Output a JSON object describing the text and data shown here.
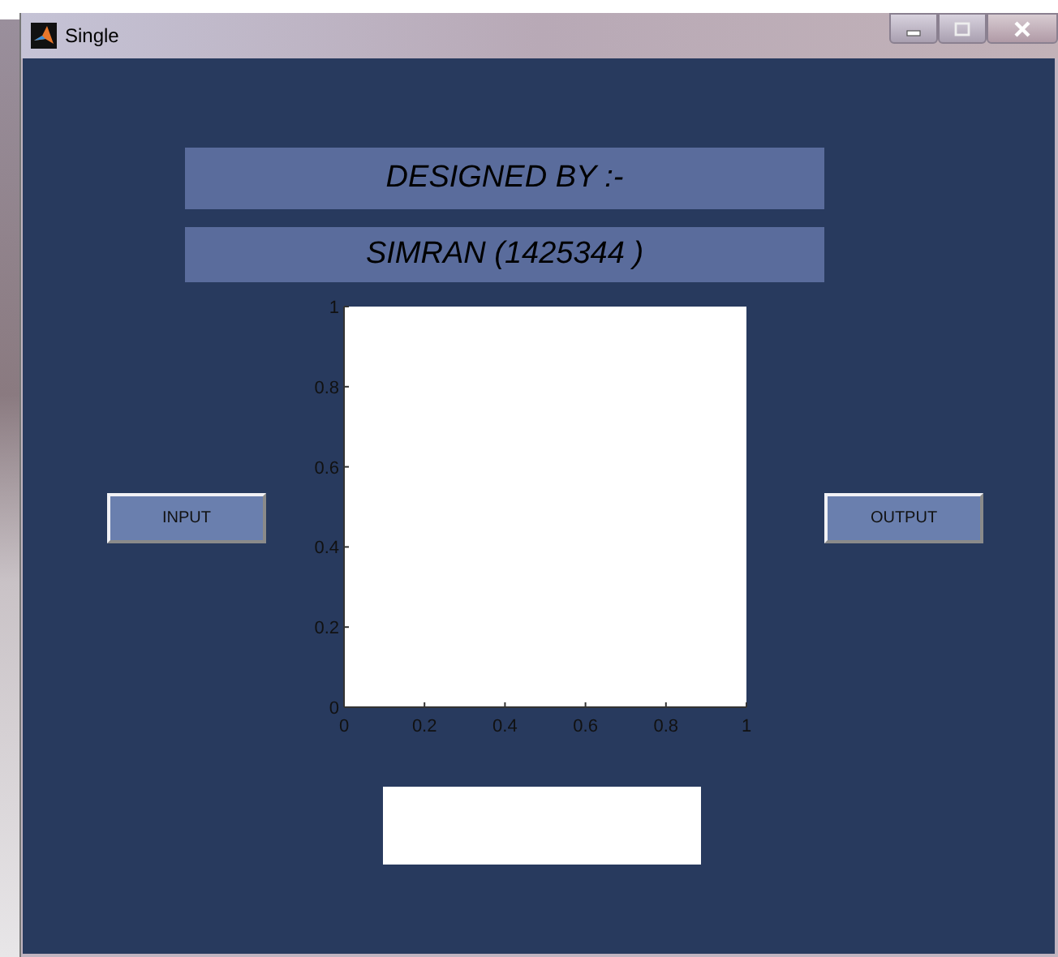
{
  "window": {
    "title": "Single"
  },
  "banners": [
    "DESIGNED BY :-",
    "SIMRAN (1425344 )"
  ],
  "buttons": [
    "INPUT",
    "OUTPUT"
  ],
  "axes": {
    "chart_data": {
      "type": "line",
      "xlim": [
        0,
        1
      ],
      "ylim": [
        0,
        1
      ],
      "xticks": [
        {
          "value": 0,
          "label": "0"
        },
        {
          "value": 0.2,
          "label": "0.2"
        },
        {
          "value": 0.4,
          "label": "0.4"
        },
        {
          "value": 0.6,
          "label": "0.6"
        },
        {
          "value": 0.8,
          "label": "0.8"
        },
        {
          "value": 1,
          "label": "1"
        }
      ],
      "yticks": [
        {
          "value": 0,
          "label": "0"
        },
        {
          "value": 0.2,
          "label": "0.2"
        },
        {
          "value": 0.4,
          "label": "0.4"
        },
        {
          "value": 0.6,
          "label": "0.6"
        },
        {
          "value": 0.8,
          "label": "0.8"
        },
        {
          "value": 1,
          "label": "1"
        }
      ]
    }
  }
}
